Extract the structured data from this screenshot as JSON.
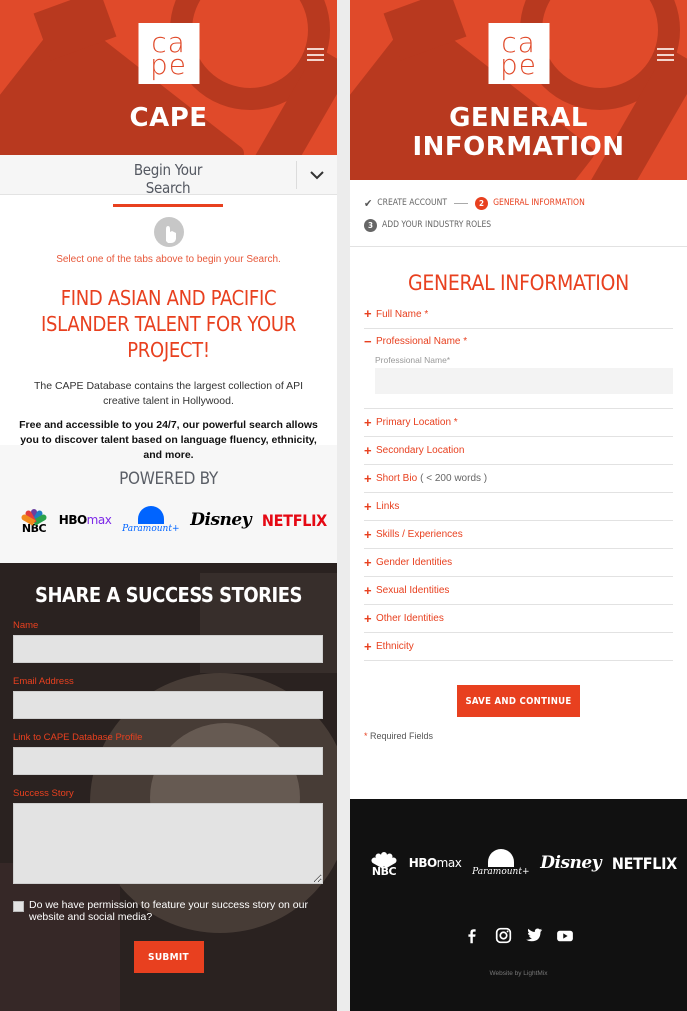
{
  "colors": {
    "brand": "#e8401f",
    "hero_bg": "#e04a2a",
    "hero_shadow": "#b8391f",
    "footer_bg": "#111111"
  },
  "left": {
    "logo": {
      "line1": "ca",
      "line2": "pe"
    },
    "hero_title": "CAPE",
    "search_tab": "Begin Your Search",
    "hint": "Select one of the tabs above to begin your Search.",
    "headline": "FIND ASIAN AND PACIFIC ISLANDER TALENT FOR YOUR PROJECT!",
    "description": "The CAPE Database contains the largest collection of API creative talent in Hollywood.",
    "description_bold": "Free and accessible to you 24/7, our powerful search allows you to discover talent based on language fluency, ethnicity, and more.",
    "powered_by": "POWERED BY",
    "partners": {
      "nbc": "NBC",
      "hbo_a": "HBO",
      "hbo_b": "max",
      "paramount": "Paramount+",
      "disney": "Disney",
      "netflix": "NETFLIX"
    },
    "stories": {
      "title": "SHARE A SUCCESS STORIES",
      "fields": [
        {
          "label": "Name",
          "value": ""
        },
        {
          "label": "Email Address",
          "value": ""
        },
        {
          "label": "Link to CAPE Database Profile",
          "value": ""
        },
        {
          "label": "Success Story",
          "value": ""
        }
      ],
      "permission": "Do we have permission to feature your success story on our website and social media?",
      "permission_checked": false,
      "submit": "SUBMIT"
    }
  },
  "right": {
    "logo": {
      "line1": "ca",
      "line2": "pe"
    },
    "hero_title_1": "GENERAL",
    "hero_title_2": "INFORMATION",
    "steps": [
      {
        "num": "✔",
        "label": "CREATE ACCOUNT",
        "state": "done"
      },
      {
        "num": "2",
        "label": "GENERAL INFORMATION",
        "state": "active"
      },
      {
        "num": "3",
        "label": "ADD YOUR INDUSTRY ROLES",
        "state": "todo"
      }
    ],
    "section_title": "GENERAL INFORMATION",
    "accordion": [
      {
        "label": "Full Name *",
        "note": "",
        "open": false
      },
      {
        "label": "Professional Name *",
        "note": "",
        "open": true,
        "field_label": "Professional Name*",
        "field_value": ""
      },
      {
        "label": "Primary Location *",
        "note": "",
        "open": false
      },
      {
        "label": "Secondary Location",
        "note": "",
        "open": false
      },
      {
        "label": "Short Bio",
        "note": "( < 200 words )",
        "open": false
      },
      {
        "label": "Links",
        "note": "",
        "open": false
      },
      {
        "label": "Skills / Experiences",
        "note": "",
        "open": false
      },
      {
        "label": "Gender Identities",
        "note": "",
        "open": false
      },
      {
        "label": "Sexual Identities",
        "note": "",
        "open": false
      },
      {
        "label": "Other Identities",
        "note": "",
        "open": false
      },
      {
        "label": "Ethnicity",
        "note": "",
        "open": false
      }
    ],
    "save_button": "SAVE AND CONTINUE",
    "required_star": "*",
    "required_note": "Required Fields",
    "footer": {
      "partners": {
        "nbc": "NBC",
        "hbo_a": "HBO",
        "hbo_b": "max",
        "paramount": "Paramount+",
        "disney": "Disney",
        "netflix": "NETFLIX"
      },
      "social": [
        "facebook",
        "instagram",
        "twitter",
        "youtube"
      ],
      "credit": "Website by LightMix"
    }
  }
}
